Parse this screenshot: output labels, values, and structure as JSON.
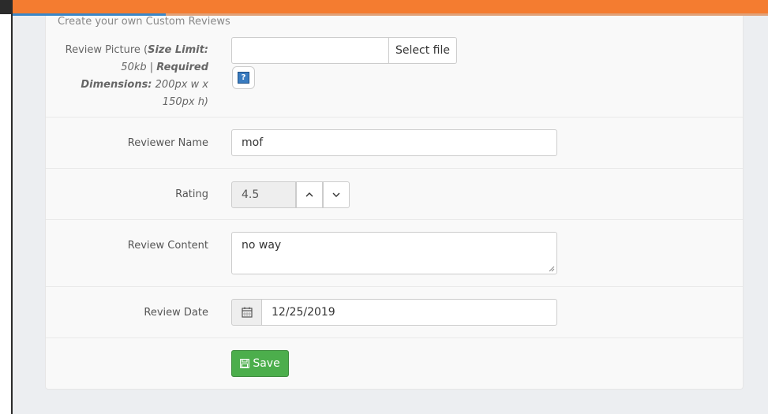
{
  "header": {
    "subtitle": "Create your own Custom Reviews"
  },
  "form": {
    "picture": {
      "label_prefix": "Review Picture (",
      "size_label": "Size Limit:",
      "size_value": " 50kb | ",
      "dims_label": "Required Dimensions:",
      "dims_value": " 200px w x 150px h)",
      "file_value": "",
      "select_label": "Select file",
      "help_glyph": "?"
    },
    "reviewer_name": {
      "label": "Reviewer Name",
      "value": "mof"
    },
    "rating": {
      "label": "Rating",
      "value": "4.5",
      "up_glyph": "⌃",
      "down_glyph": "⌄"
    },
    "review_content": {
      "label": "Review Content",
      "value": "no way"
    },
    "review_date": {
      "label": "Review Date",
      "value": "12/25/2019"
    },
    "save_label": "Save"
  },
  "icons": {
    "help": "help-icon",
    "calendar": "calendar-icon",
    "save": "floppy-disk-icon",
    "spinner_up": "chevron-up-icon",
    "spinner_down": "chevron-down-icon"
  },
  "colors": {
    "topbar": "#f47c30",
    "accent_blue": "#3a87c7",
    "save_green": "#4cae4c"
  }
}
